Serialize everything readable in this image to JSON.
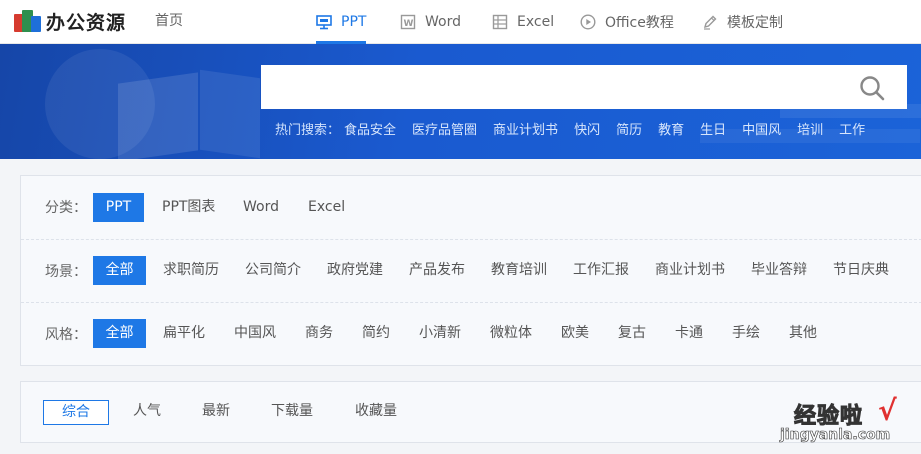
{
  "logo": {
    "text": "办公资源"
  },
  "nav": {
    "home": "首页",
    "items": [
      {
        "label": "PPT",
        "icon": "presentation-icon",
        "active": true
      },
      {
        "label": "Word",
        "icon": "word-doc-icon",
        "active": false
      },
      {
        "label": "Excel",
        "icon": "excel-sheet-icon",
        "active": false
      },
      {
        "label": "Office教程",
        "icon": "play-circle-icon",
        "active": false
      },
      {
        "label": "模板定制",
        "icon": "pen-icon",
        "active": false
      }
    ]
  },
  "search": {
    "placeholder": "",
    "hot_label": "热门搜索：",
    "hot_items": [
      "食品安全",
      "医疗品管圈",
      "商业计划书",
      "快闪",
      "简历",
      "教育",
      "生日",
      "中国风",
      "培训",
      "工作"
    ]
  },
  "filters": {
    "category": {
      "label": "分类：",
      "options": [
        "PPT",
        "PPT图表",
        "Word",
        "Excel"
      ],
      "selected": "PPT"
    },
    "scene": {
      "label": "场景：",
      "options": [
        "全部",
        "求职简历",
        "公司简介",
        "政府党建",
        "产品发布",
        "教育培训",
        "工作汇报",
        "商业计划书",
        "毕业答辩",
        "节日庆典"
      ],
      "selected": "全部"
    },
    "style": {
      "label": "风格：",
      "options": [
        "全部",
        "扁平化",
        "中国风",
        "商务",
        "简约",
        "小清新",
        "微粒体",
        "欧美",
        "复古",
        "卡通",
        "手绘",
        "其他"
      ],
      "selected": "全部"
    }
  },
  "sort": {
    "options": [
      "综合",
      "人气",
      "最新",
      "下载量",
      "收藏量"
    ],
    "selected": "综合"
  },
  "watermark": {
    "title": "经验啦",
    "check": "√",
    "url": "jingyanla.com"
  },
  "colors": {
    "accent": "#1e78e6",
    "banner": "#1b58cf",
    "panel_bg": "#f7f9fc"
  }
}
